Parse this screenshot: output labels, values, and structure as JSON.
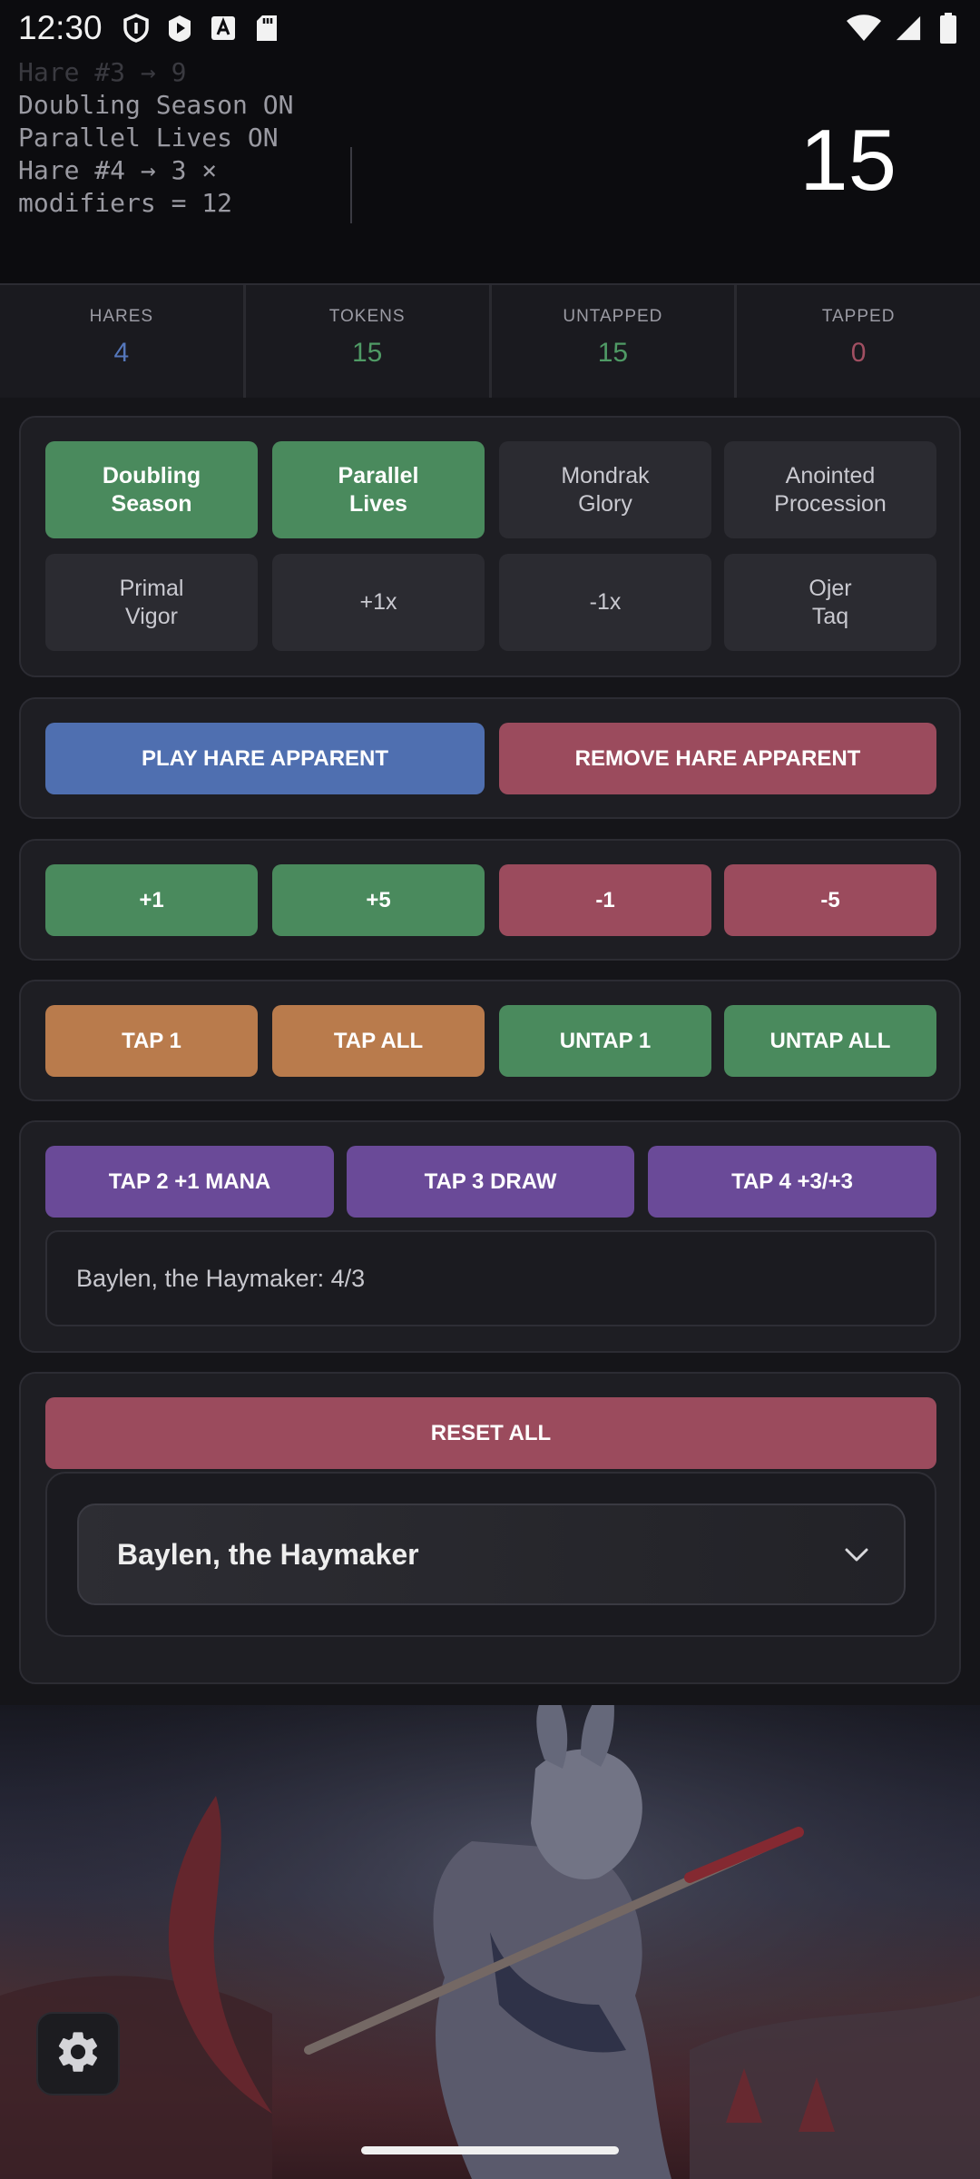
{
  "status_bar": {
    "time": "12:30",
    "icons_left": [
      "shield-icon",
      "play-store-icon",
      "font-icon",
      "sd-card-icon"
    ],
    "icons_right": [
      "wifi-icon",
      "signal-icon",
      "battery-icon"
    ]
  },
  "log": {
    "lines": [
      "Hare #3 → 9",
      "Doubling Season ON",
      "Parallel Lives ON",
      "Hare #4 → 3 ×",
      "modifiers = 12"
    ]
  },
  "token_total": "15",
  "stats": [
    {
      "label": "HARES",
      "value": "4",
      "color": "#5577bb"
    },
    {
      "label": "TOKENS",
      "value": "15",
      "color": "#4f9a65"
    },
    {
      "label": "UNTAPPED",
      "value": "15",
      "color": "#4f9a65"
    },
    {
      "label": "TAPPED",
      "value": "0",
      "color": "#a14f62"
    }
  ],
  "modifiers": [
    {
      "label": "Doubling\nSeason",
      "active": true
    },
    {
      "label": "Parallel\nLives",
      "active": true
    },
    {
      "label": "Mondrak\nGlory",
      "active": false
    },
    {
      "label": "Anointed\nProcession",
      "active": false
    },
    {
      "label": "Primal\nVigor",
      "active": false
    },
    {
      "label": "+1x",
      "active": false
    },
    {
      "label": "-1x",
      "active": false
    },
    {
      "label": "Ojer\nTaq",
      "active": false
    }
  ],
  "hare_actions": {
    "play": "PLAY HARE APPARENT",
    "remove": "REMOVE HARE APPARENT"
  },
  "token_adjust": {
    "plus1": "+1",
    "plus5": "+5",
    "minus1": "-1",
    "minus5": "-5"
  },
  "tap_actions": {
    "tap1": "TAP 1",
    "tap_all": "TAP ALL",
    "untap1": "UNTAP 1",
    "untap_all": "UNTAP ALL"
  },
  "abilities": {
    "mana": "TAP 2 +1 MANA",
    "draw": "TAP 3 DRAW",
    "pump": "TAP 4 +3/+3"
  },
  "commander_stats": "Baylen, the Haymaker: 4/3",
  "reset_label": "RESET ALL",
  "commander_select": {
    "selected": "Baylen, the Haymaker"
  },
  "colors": {
    "green": "#4a8a5d",
    "red": "#9b4b5d",
    "blue": "#4f6fb0",
    "orange": "#b97b4c",
    "purple": "#6a4a98"
  }
}
